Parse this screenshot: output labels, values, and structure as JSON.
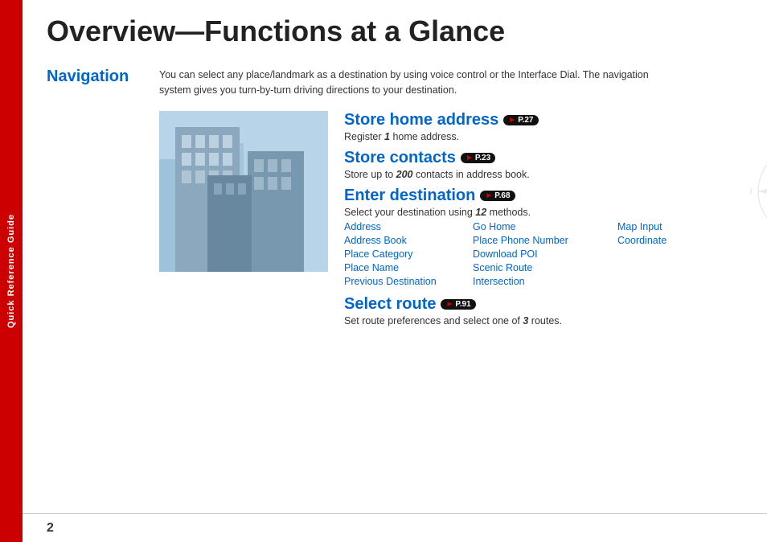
{
  "sidebar": {
    "tab_label": "Quick Reference Guide"
  },
  "page": {
    "title": "Overview—Functions at a Glance",
    "number": "2"
  },
  "navigation_section": {
    "label": "Navigation",
    "intro": "You can select any place/landmark as a destination by using voice control or the Interface Dial. The navigation system gives you turn-by-turn driving directions to your destination."
  },
  "features": [
    {
      "id": "store-home",
      "title": "Store home address",
      "badge": "P.27",
      "desc_prefix": "Register ",
      "desc_bold": "1",
      "desc_suffix": " home address."
    },
    {
      "id": "store-contacts",
      "title": "Store contacts",
      "badge": "P.23",
      "desc_prefix": "Store up to ",
      "desc_bold": "200",
      "desc_suffix": " contacts in address book."
    },
    {
      "id": "enter-destination",
      "title": "Enter destination",
      "badge": "P.68",
      "desc_prefix": "Select your destination using ",
      "desc_bold": "12",
      "desc_suffix": " methods."
    },
    {
      "id": "select-route",
      "title": "Select route",
      "badge": "P.91",
      "desc_prefix": "Set route preferences and select one of ",
      "desc_bold": "3",
      "desc_suffix": " routes."
    }
  ],
  "methods": {
    "col1": [
      "Address",
      "Address Book",
      "Place Category",
      "Place Name",
      "Previous Destination"
    ],
    "col2": [
      "Go Home",
      "Place Phone Number",
      "Download POI",
      "Scenic Route",
      "Intersection"
    ],
    "col3": [
      "Map Input",
      "Coordinate"
    ]
  }
}
